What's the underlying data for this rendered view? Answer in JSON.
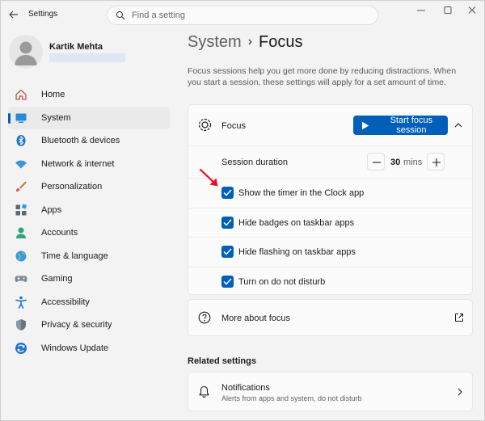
{
  "app": {
    "title": "Settings"
  },
  "search": {
    "placeholder": "Find a setting",
    "value": ""
  },
  "profile": {
    "name": "Kartik Mehta"
  },
  "sidebar": {
    "items": [
      {
        "label": "Home",
        "icon": "home-icon",
        "active": false
      },
      {
        "label": "System",
        "icon": "system-icon",
        "active": true
      },
      {
        "label": "Bluetooth & devices",
        "icon": "bluetooth-icon",
        "active": false
      },
      {
        "label": "Network & internet",
        "icon": "wifi-icon",
        "active": false
      },
      {
        "label": "Personalization",
        "icon": "brush-icon",
        "active": false
      },
      {
        "label": "Apps",
        "icon": "apps-icon",
        "active": false
      },
      {
        "label": "Accounts",
        "icon": "accounts-icon",
        "active": false
      },
      {
        "label": "Time & language",
        "icon": "globe-icon",
        "active": false
      },
      {
        "label": "Gaming",
        "icon": "gamepad-icon",
        "active": false
      },
      {
        "label": "Accessibility",
        "icon": "accessibility-icon",
        "active": false
      },
      {
        "label": "Privacy & security",
        "icon": "shield-icon",
        "active": false
      },
      {
        "label": "Windows Update",
        "icon": "update-icon",
        "active": false
      }
    ]
  },
  "breadcrumb": {
    "parent": "System",
    "separator": "›",
    "current": "Focus"
  },
  "description": "Focus sessions help you get more done by reducing distractions. When you start a session, these settings will apply for a set amount of time.",
  "focus": {
    "title": "Focus",
    "start_button": "Start focus session",
    "duration_label": "Session duration",
    "duration_value": "30",
    "duration_unit": "mins",
    "options": [
      {
        "label": "Show the timer in the Clock app",
        "checked": true
      },
      {
        "label": "Hide badges on taskbar apps",
        "checked": true
      },
      {
        "label": "Hide flashing on taskbar apps",
        "checked": true
      },
      {
        "label": "Turn on do not disturb",
        "checked": true
      }
    ]
  },
  "more_about": {
    "label": "More about focus"
  },
  "related": {
    "heading": "Related settings",
    "notifications": {
      "title": "Notifications",
      "subtitle": "Alerts from apps and system, do not disturb"
    }
  },
  "colors": {
    "accent": "#005fb8",
    "annotation_arrow": "#e81123"
  }
}
